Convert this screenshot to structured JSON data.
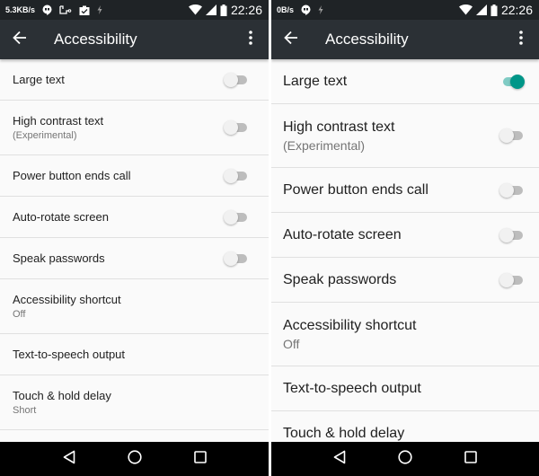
{
  "screens": [
    {
      "status_bar": {
        "net_speed": "5.3KB/s",
        "left_icons": [
          "hangouts-icon",
          "voicemail-icon",
          "clipboard-check-icon",
          "charging-icon"
        ],
        "time": "22:26"
      },
      "toolbar": {
        "title": "Accessibility",
        "back_icon": "arrow-back-icon",
        "menu_icon": "more-vert-icon"
      },
      "items": [
        {
          "label": "Large text",
          "toggle": false
        },
        {
          "label": "High contrast text",
          "summary": "(Experimental)",
          "toggle": false
        },
        {
          "label": "Power button ends call",
          "toggle": false
        },
        {
          "label": "Auto-rotate screen",
          "toggle": false
        },
        {
          "label": "Speak passwords",
          "toggle": false
        },
        {
          "label": "Accessibility shortcut",
          "summary": "Off"
        },
        {
          "label": "Text-to-speech output"
        },
        {
          "label": "Touch & hold delay",
          "summary": "Short"
        }
      ]
    },
    {
      "status_bar": {
        "net_speed": "0B/s",
        "left_icons": [
          "hangouts-icon",
          "charging-icon"
        ],
        "time": "22:26"
      },
      "toolbar": {
        "title": "Accessibility",
        "back_icon": "arrow-back-icon",
        "menu_icon": "more-vert-icon"
      },
      "items": [
        {
          "label": "Large text",
          "toggle": true
        },
        {
          "label": "High contrast text",
          "summary": "(Experimental)",
          "toggle": false
        },
        {
          "label": "Power button ends call",
          "toggle": false
        },
        {
          "label": "Auto-rotate screen",
          "toggle": false
        },
        {
          "label": "Speak passwords",
          "toggle": false
        },
        {
          "label": "Accessibility shortcut",
          "summary": "Off"
        },
        {
          "label": "Text-to-speech output"
        },
        {
          "label": "Touch & hold delay"
        }
      ]
    }
  ],
  "colors": {
    "accent": "#009688",
    "accent_track": "#80cbc4",
    "toolbar": "#2b3035",
    "status_bar": "#1f2326"
  }
}
